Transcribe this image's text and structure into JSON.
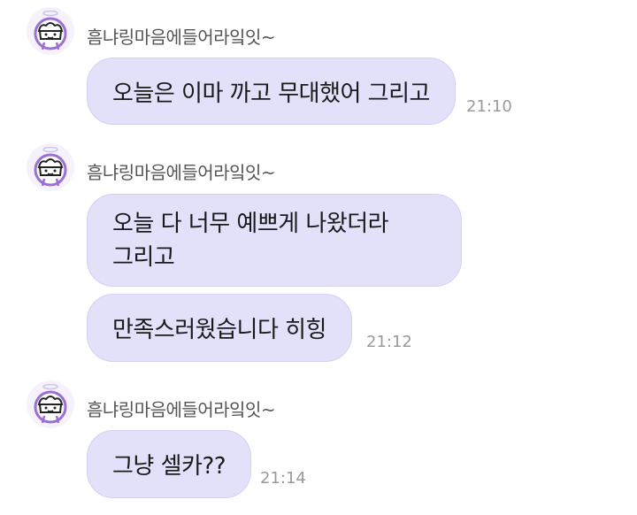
{
  "chat": {
    "groups": [
      {
        "sender": "흠냐링마음에들어라잌잇~",
        "avatar_icon": "character-avatar-icon",
        "messages": [
          {
            "lines": [
              "오늘은 이마 까고 무대했어 그리고"
            ],
            "time": "21:10"
          }
        ]
      },
      {
        "sender": "흠냐링마음에들어라잌잇~",
        "avatar_icon": "character-avatar-icon",
        "messages": [
          {
            "lines": [
              "오늘 다 너무 예쁘게 나왔더라",
              "그리고"
            ],
            "time": ""
          },
          {
            "lines": [
              "만족스러웠습니다 히힝"
            ],
            "time": "21:12"
          }
        ]
      },
      {
        "sender": "흠냐링마음에들어라잌잇~",
        "avatar_icon": "character-avatar-icon",
        "messages": [
          {
            "lines": [
              "그냥 셀카??"
            ],
            "time": "21:14"
          }
        ]
      }
    ]
  },
  "colors": {
    "bubble_bg": "#e3e1fa",
    "bubble_border": "#d4d1f2",
    "avatar_accent": "#9b6fd4"
  }
}
